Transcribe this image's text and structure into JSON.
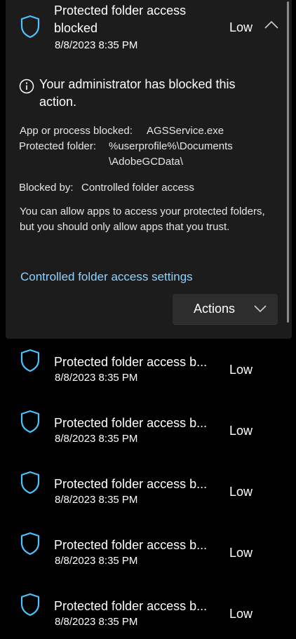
{
  "expanded": {
    "title": "Protected folder access blocked",
    "date": "8/8/2023 8:35 PM",
    "severity": "Low",
    "info_heading": "Your administrator has blocked this action.",
    "details": {
      "app_label": "App or process blocked:",
      "app_value": "AGSService.exe",
      "folder_label": "Protected folder:",
      "folder_value_line1": "%userprofile%\\Documents",
      "folder_value_line2": "\\AdobeGCData\\",
      "blocked_by_label": "Blocked by:",
      "blocked_by_value": "Controlled folder access"
    },
    "description": "You can allow apps to access your protected folders, but you should only allow apps that you trust.",
    "settings_link": "Controlled folder access settings",
    "actions_label": "Actions"
  },
  "rows": [
    {
      "title": "Protected folder access b...",
      "date": "8/8/2023 8:35 PM",
      "severity": "Low"
    },
    {
      "title": "Protected folder access b...",
      "date": "8/8/2023 8:35 PM",
      "severity": "Low"
    },
    {
      "title": "Protected folder access b...",
      "date": "8/8/2023 8:35 PM",
      "severity": "Low"
    },
    {
      "title": "Protected folder access b...",
      "date": "8/8/2023 8:35 PM",
      "severity": "Low"
    },
    {
      "title": "Protected folder access b...",
      "date": "8/8/2023 8:35 PM",
      "severity": "Low"
    }
  ],
  "colors": {
    "accent_shield": "#4cc2ff",
    "link": "#8fd3ff",
    "card_bg": "#1c1c1c",
    "page_bg": "#000000"
  },
  "icons": {
    "row_icon": "shield-icon",
    "info": "info-icon",
    "collapse": "chevron-up-icon",
    "actions": "chevron-down-icon"
  }
}
